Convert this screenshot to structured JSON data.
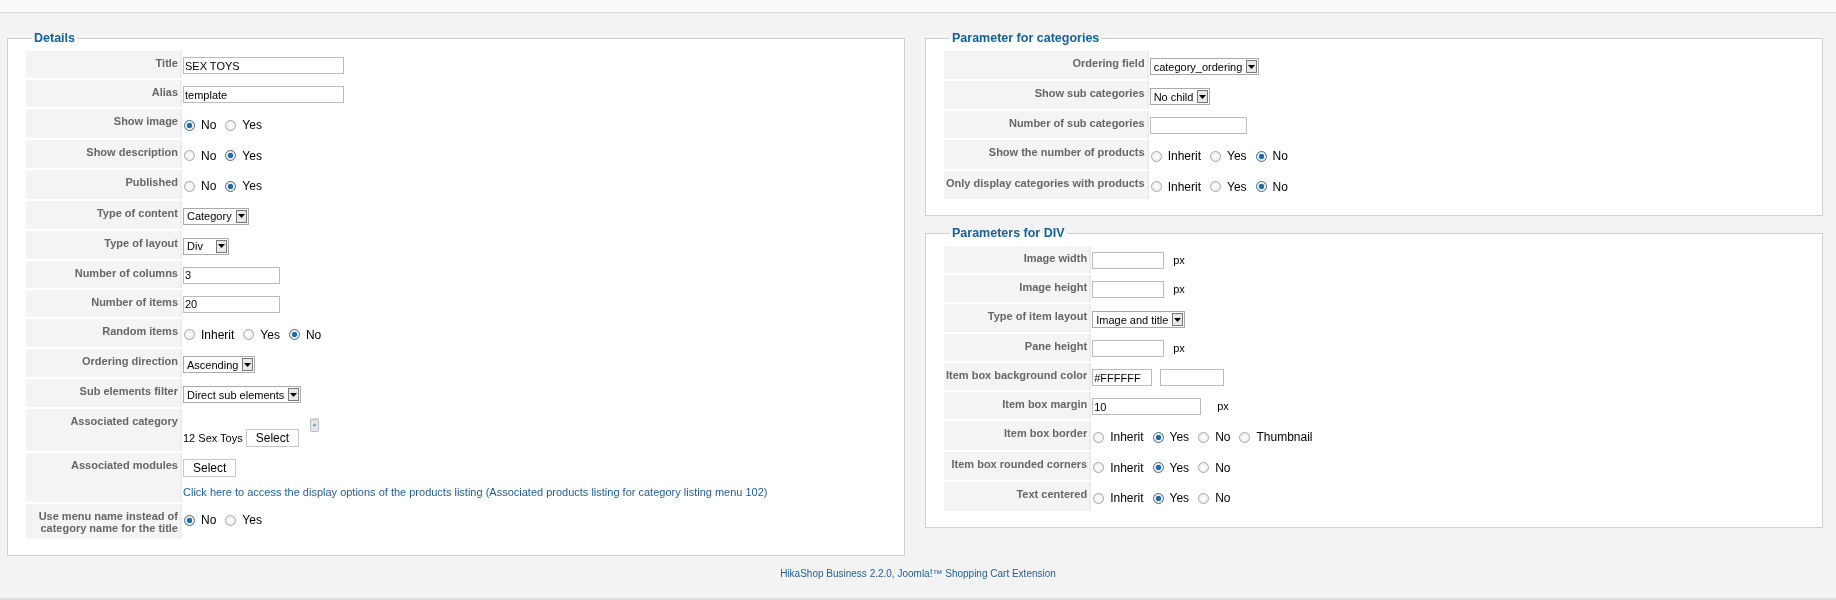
{
  "columns": [
    {
      "panels": [
        {
          "title": "Details",
          "rows": [
            {
              "label": "Title",
              "kind": "text",
              "value": "SEX TOYS"
            },
            {
              "label": "Alias",
              "kind": "text",
              "value": "template"
            },
            {
              "label": "Show image",
              "kind": "radio",
              "options": [
                {
                  "label": "No",
                  "selected": true
                },
                {
                  "label": "Yes",
                  "selected": false
                }
              ]
            },
            {
              "label": "Show description",
              "kind": "radio",
              "options": [
                {
                  "label": "No",
                  "selected": false
                },
                {
                  "label": "Yes",
                  "selected": true
                }
              ]
            },
            {
              "label": "Published",
              "kind": "radio",
              "options": [
                {
                  "label": "No",
                  "selected": false
                },
                {
                  "label": "Yes",
                  "selected": true
                }
              ]
            },
            {
              "label": "Type of content",
              "kind": "select",
              "value": "Category"
            },
            {
              "label": "Type of layout",
              "kind": "select",
              "value": "Div"
            },
            {
              "label": "Number of columns",
              "kind": "short_text",
              "value": "3"
            },
            {
              "label": "Number of items",
              "kind": "short_text",
              "value": "20"
            },
            {
              "label": "Random items",
              "kind": "radio",
              "options": [
                {
                  "label": "Inherit",
                  "selected": false
                },
                {
                  "label": "Yes",
                  "selected": false
                },
                {
                  "label": "No",
                  "selected": true
                }
              ]
            },
            {
              "label": "Ordering direction",
              "kind": "select",
              "value": "Ascending"
            },
            {
              "label": "Sub elements filter",
              "kind": "select",
              "value": "Direct sub elements"
            },
            {
              "label": "Associated category",
              "kind": "category",
              "value": "12 Sex Toys",
              "button": "Select"
            },
            {
              "label": "Associated modules",
              "kind": "modules",
              "button": "Select",
              "link": "Click here to access the display options of the products listing (Associated products listing for category listing menu 102)"
            },
            {
              "label": "Use menu name instead of category name for the title",
              "kind": "radio",
              "options": [
                {
                  "label": "No",
                  "selected": true
                },
                {
                  "label": "Yes",
                  "selected": false
                }
              ]
            }
          ]
        }
      ]
    },
    {
      "panels": [
        {
          "title": "Parameter for categories",
          "rows": [
            {
              "label": "Ordering field",
              "kind": "select",
              "value": "category_ordering"
            },
            {
              "label": "Show sub categories",
              "kind": "select",
              "value": "No child"
            },
            {
              "label": "Number of sub categories",
              "kind": "short_text"
            },
            {
              "label": "Show the number of products",
              "kind": "radio",
              "options": [
                {
                  "label": "Inherit",
                  "selected": false
                },
                {
                  "label": "Yes",
                  "selected": false
                },
                {
                  "label": "No",
                  "selected": true
                }
              ]
            },
            {
              "label": "Only display categories with products",
              "kind": "radio",
              "options": [
                {
                  "label": "Inherit",
                  "selected": false
                },
                {
                  "label": "Yes",
                  "selected": false
                },
                {
                  "label": "No",
                  "selected": true
                }
              ]
            }
          ]
        },
        {
          "title": "Parameters for DIV",
          "rows": [
            {
              "label": "Image width",
              "kind": "text_px",
              "unit": "px"
            },
            {
              "label": "Image height",
              "kind": "text_px",
              "unit": "px"
            },
            {
              "label": "Type of item layout",
              "kind": "select",
              "value": "Image and title"
            },
            {
              "label": "Pane height",
              "kind": "text_px",
              "unit": "px"
            },
            {
              "label": "Item box background color",
              "kind": "color",
              "value": "#FFFFFF"
            },
            {
              "label": "Item box margin",
              "kind": "wide_px",
              "value": "10",
              "unit": "px"
            },
            {
              "label": "Item box border",
              "kind": "radio",
              "options": [
                {
                  "label": "Inherit",
                  "selected": false
                },
                {
                  "label": "Yes",
                  "selected": true
                },
                {
                  "label": "No",
                  "selected": false
                },
                {
                  "label": "Thumbnail",
                  "selected": false
                }
              ]
            },
            {
              "label": "Item box rounded corners",
              "kind": "radio",
              "options": [
                {
                  "label": "Inherit",
                  "selected": false
                },
                {
                  "label": "Yes",
                  "selected": true
                },
                {
                  "label": "No",
                  "selected": false
                }
              ]
            },
            {
              "label": "Text centered",
              "kind": "radio",
              "options": [
                {
                  "label": "Inherit",
                  "selected": false
                },
                {
                  "label": "Yes",
                  "selected": true
                },
                {
                  "label": "No",
                  "selected": false
                }
              ]
            }
          ]
        }
      ]
    }
  ],
  "footer": "HikaShop Business 2.2.0, Joomla!™ Shopping Cart Extension"
}
